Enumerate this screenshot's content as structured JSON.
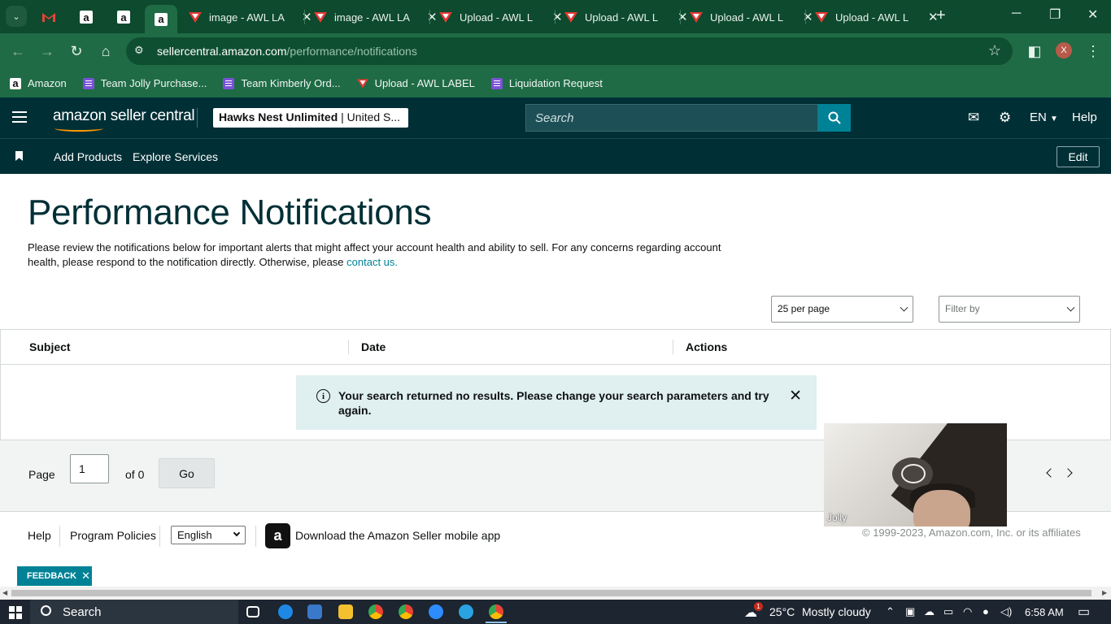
{
  "browser": {
    "tabs": [
      {
        "title": "image - AWL LA",
        "close": "✕"
      },
      {
        "title": "image - AWL LA",
        "close": "✕"
      },
      {
        "title": "Upload - AWL L",
        "close": "✕"
      },
      {
        "title": "Upload - AWL L",
        "close": "✕"
      },
      {
        "title": "Upload - AWL L",
        "close": "✕"
      },
      {
        "title": "Upload - AWL L",
        "close": "✕"
      }
    ],
    "url_host": "sellercentral.amazon.com",
    "url_path": "/performance/notifications",
    "profile_initial": "X",
    "bookmarks": [
      {
        "label": "Amazon"
      },
      {
        "label": "Team Jolly Purchase..."
      },
      {
        "label": "Team Kimberly Ord..."
      },
      {
        "label": "Upload - AWL LABEL"
      },
      {
        "label": "Liquidation Request"
      }
    ]
  },
  "header": {
    "logo_text": "amazon seller central",
    "account_name": "Hawks Nest Unlimited",
    "account_region": " | United S...",
    "search_placeholder": "Search",
    "language": "EN",
    "help": "Help"
  },
  "subnav": {
    "add_products": "Add Products",
    "explore_services": "Explore Services",
    "edit": "Edit"
  },
  "page": {
    "title": "Performance Notifications",
    "description": "Please review the notifications below for important alerts that might affect your account health and ability to sell. For any concerns regarding account health, please respond to the notification directly. Otherwise, please ",
    "contact_link": "contact us.",
    "per_page": "25 per page",
    "filter_placeholder": "Filter by"
  },
  "table": {
    "columns": [
      "Subject",
      "Date",
      "Actions"
    ],
    "alert_message": "Your search returned no results. Please change your search parameters and try again."
  },
  "pager": {
    "page_label": "Page",
    "page_value": "1",
    "of_label": "of 0",
    "go_label": "Go"
  },
  "footer": {
    "help": "Help",
    "program_policies": "Program Policies",
    "language": "English",
    "download_app": "Download the Amazon Seller mobile app",
    "copyright": "© 1999-2023, Amazon.com, Inc. or its affiliates",
    "feedback": "FEEDBACK"
  },
  "video": {
    "name": "Jolly"
  },
  "taskbar": {
    "search": "Search",
    "weather_temp": "25°C",
    "weather_desc": "Mostly cloudy",
    "notification_count": "1",
    "time": "6:58 AM"
  },
  "colors": {
    "browser_frame": "#0d4a2e",
    "browser_toolbar": "#1f6b45",
    "seller_header": "#002f36",
    "accent_teal": "#008296",
    "alert_bg": "#e0eff0"
  }
}
